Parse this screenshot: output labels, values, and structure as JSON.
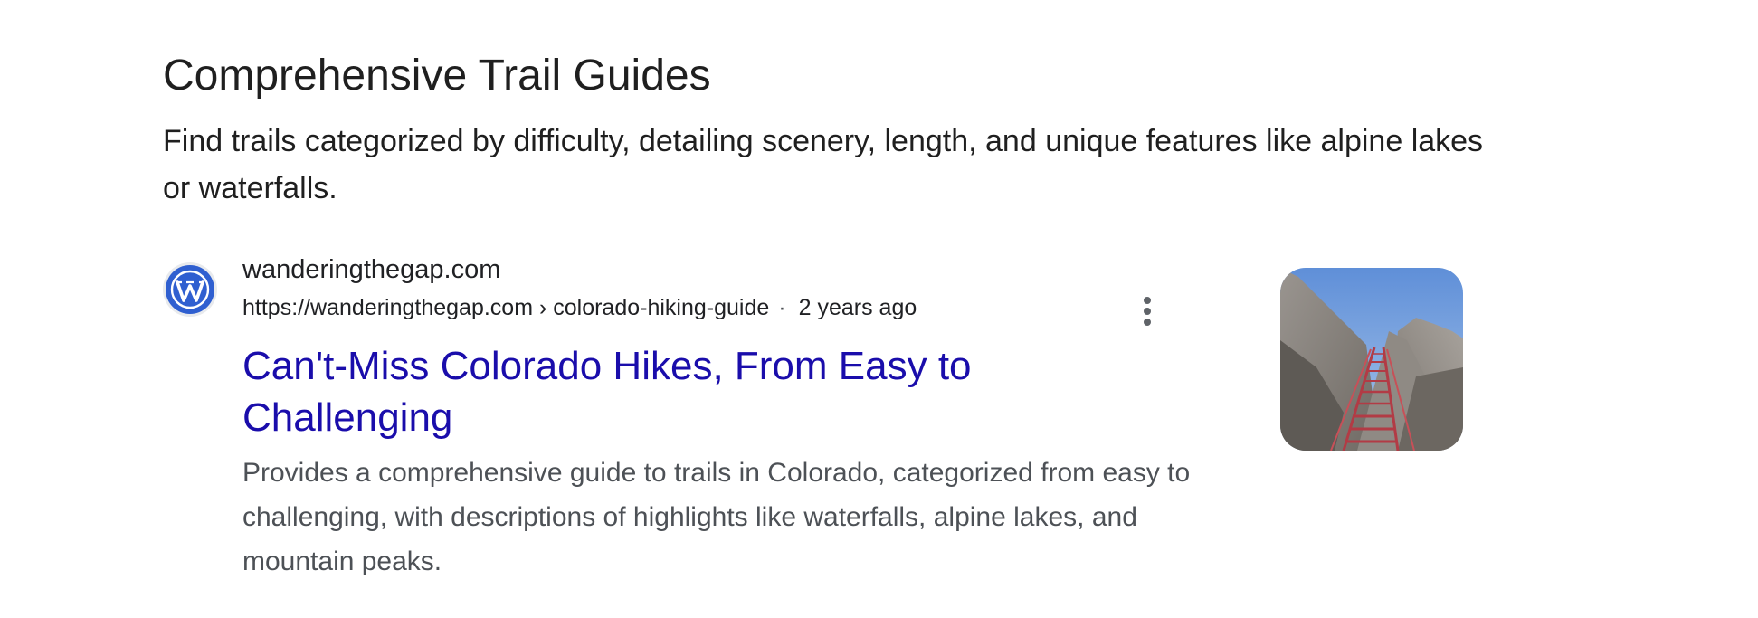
{
  "section": {
    "title": "Comprehensive Trail Guides",
    "description": "Find trails categorized by difficulty, detailing scenery, length, and unique features like alpine lakes or waterfalls."
  },
  "result": {
    "favicon_icon": "wordpress-icon",
    "site_name": "wanderingthegap.com",
    "url": "https://wanderingthegap.com › colorado-hiking-guide",
    "separator": "·",
    "date": "2 years ago",
    "more_icon": "more-vert-icon",
    "title": "Can't-Miss Colorado Hikes, From Easy to Challenging",
    "snippet": "Provides a comprehensive guide to trails in Colorado, categorized from easy to challenging, with descriptions of highlights like waterfalls, alpine lakes, and mountain peaks.",
    "thumbnail_icon": "thumbnail-image"
  },
  "colors": {
    "link": "#1a0dab",
    "text": "#202124",
    "snippet": "#4d5156",
    "favicon": "#2f5fd0"
  }
}
